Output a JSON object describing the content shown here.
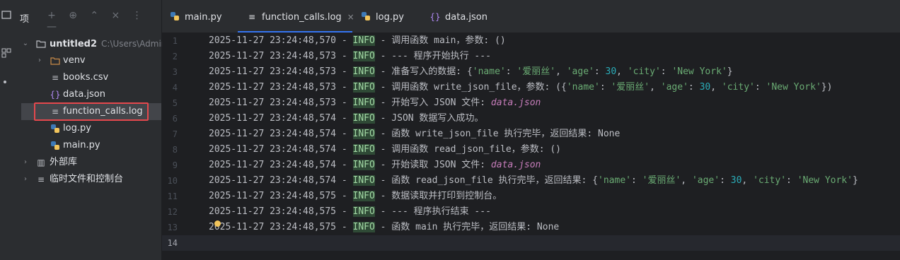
{
  "sidebar_strip": {
    "icons": [
      "project-icon",
      "structure-icon",
      "more-icon"
    ]
  },
  "project": {
    "title": "项",
    "tools": [
      "+",
      "⊕",
      "⌃",
      "×",
      "⋮",
      "—"
    ],
    "tree": [
      {
        "label": "untitled2",
        "path": "C:\\Users\\Admin\\",
        "icon": "folder-icon",
        "expanded": true
      },
      {
        "label": "venv",
        "icon": "folder-icon",
        "expanded": false
      },
      {
        "label": "books.csv",
        "icon": "text-file-icon"
      },
      {
        "label": "data.json",
        "icon": "json-file-icon"
      },
      {
        "label": "function_calls.log",
        "icon": "text-file-icon",
        "selected": true
      },
      {
        "label": "log.py",
        "icon": "python-file-icon"
      },
      {
        "label": "main.py",
        "icon": "python-file-icon"
      },
      {
        "label": "外部库",
        "icon": "library-icon",
        "expanded": false
      },
      {
        "label": "临时文件和控制台",
        "icon": "scratch-icon",
        "expanded": false
      }
    ]
  },
  "tabs": [
    {
      "label": "main.py",
      "icon": "python-file-icon"
    },
    {
      "label": "function_calls.log",
      "icon": "text-file-icon",
      "active": true,
      "close": "×"
    },
    {
      "label": "log.py",
      "icon": "python-file-icon"
    },
    {
      "label": "data.json",
      "icon": "json-file-icon"
    }
  ],
  "editor": {
    "line_numbers": [
      "1",
      "2",
      "3",
      "4",
      "5",
      "6",
      "7",
      "8",
      "9",
      "10",
      "11",
      "12",
      "13",
      "14"
    ],
    "current_line": "14",
    "lines": [
      {
        "ts": "2025-11-27 23:24:48,570",
        "level": "INFO",
        "msg": "调用函数 main，参数: ()"
      },
      {
        "ts": "2025-11-27 23:24:48,573",
        "level": "INFO",
        "msg": "--- 程序开始执行 ---"
      },
      {
        "ts": "2025-11-27 23:24:48,573",
        "level": "INFO",
        "msg": "准备写入的数据: {'name': '爱丽丝', 'age': 30, 'city': 'New York'}"
      },
      {
        "ts": "2025-11-27 23:24:48,573",
        "level": "INFO",
        "msg": "调用函数 write_json_file，参数: ({'name': '爱丽丝', 'age': 30, 'city': 'New York'})"
      },
      {
        "ts": "2025-11-27 23:24:48,573",
        "level": "INFO",
        "msg": "开始写入 JSON 文件: data.json"
      },
      {
        "ts": "2025-11-27 23:24:48,574",
        "level": "INFO",
        "msg": "JSON 数据写入成功。"
      },
      {
        "ts": "2025-11-27 23:24:48,574",
        "level": "INFO",
        "msg": "函数 write_json_file 执行完毕，返回结果: None"
      },
      {
        "ts": "2025-11-27 23:24:48,574",
        "level": "INFO",
        "msg": "调用函数 read_json_file，参数: ()"
      },
      {
        "ts": "2025-11-27 23:24:48,574",
        "level": "INFO",
        "msg": "开始读取 JSON 文件: data.json"
      },
      {
        "ts": "2025-11-27 23:24:48,574",
        "level": "INFO",
        "msg": "函数 read_json_file 执行完毕，返回结果: {'name': '爱丽丝', 'age': 30, 'city': 'New York'}"
      },
      {
        "ts": "2025-11-27 23:24:48,575",
        "level": "INFO",
        "msg": "数据读取并打印到控制台。"
      },
      {
        "ts": "2025-11-27 23:24:48,575",
        "level": "INFO",
        "msg": "--- 程序执行结束 ---"
      },
      {
        "ts": "2025-11-27 23:24:48,575",
        "level": "INFO",
        "msg": "函数 main 执行完毕，返回结果: None"
      }
    ]
  },
  "colors": {
    "accent": "#3574f0",
    "highlight_box": "#e5484d",
    "info_bg": "#2f4a36"
  }
}
